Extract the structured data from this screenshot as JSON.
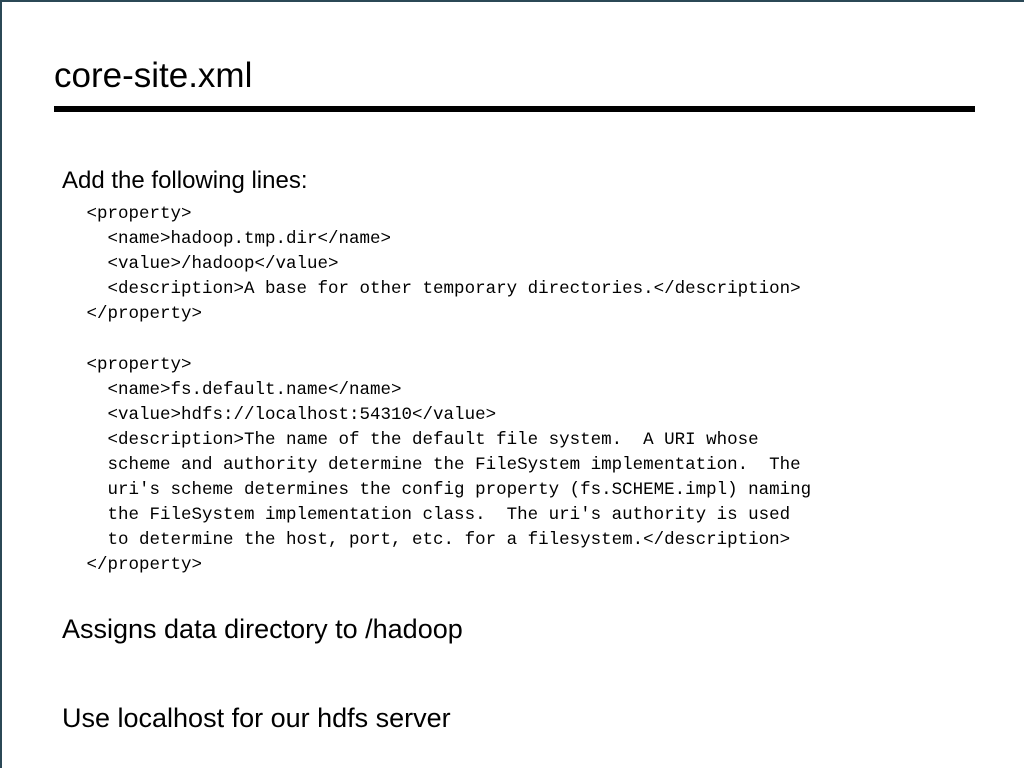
{
  "slide": {
    "title": "core-site.xml",
    "accent_color": "#2b4856",
    "rule_color": "#000000",
    "background_color": "#ffffff",
    "text_color": "#000000"
  },
  "body": {
    "lead_line": "Add the following lines:",
    "code_lines": [
      " <property>",
      "   <name>hadoop.tmp.dir</name>",
      "   <value>/hadoop</value>",
      "   <description>A base for other temporary directories.</description>",
      " </property>",
      "",
      " <property>",
      "   <name>fs.default.name</name>",
      "   <value>hdfs://localhost:54310</value>",
      "   <description>The name of the default file system.  A URI whose",
      "   scheme and authority determine the FileSystem implementation.  The",
      "   uri's scheme determines the config property (fs.SCHEME.impl) naming",
      "   the FileSystem implementation class.  The uri's authority is used",
      "   to determine the host, port, etc. for a filesystem.</description>",
      " </property>"
    ]
  },
  "summary": {
    "line_1": "Assigns data directory to /hadoop",
    "line_2": "Use localhost for our hdfs server"
  }
}
